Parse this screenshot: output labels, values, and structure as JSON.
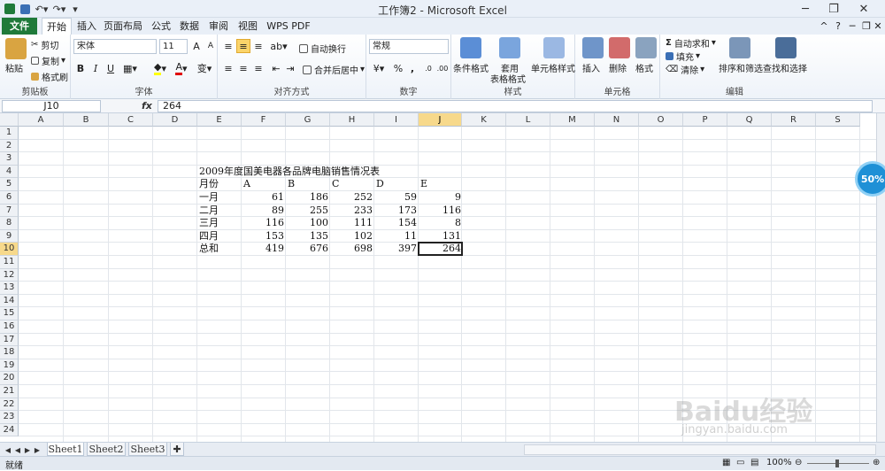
{
  "window": {
    "title": "工作簿2 - Microsoft Excel"
  },
  "tabs": [
    "文件",
    "开始",
    "插入",
    "页面布局",
    "公式",
    "数据",
    "审阅",
    "视图",
    "WPS PDF"
  ],
  "ribbon": {
    "clipboard": {
      "paste": "粘贴",
      "cut": "剪切",
      "copy": "复制",
      "format_painter": "格式刷",
      "label": "剪贴板"
    },
    "font": {
      "name": "宋体",
      "size": "11",
      "bold": "B",
      "italic": "I",
      "underline": "U",
      "label": "字体"
    },
    "alignment": {
      "wrap": "自动换行",
      "merge": "合并后居中",
      "label": "对齐方式"
    },
    "number": {
      "format": "常规",
      "percent": "%",
      "comma": ",",
      "label": "数字"
    },
    "styles": {
      "conditional": "条件格式",
      "table_format_1": "套用",
      "table_format_2": "表格格式",
      "cell_styles": "单元格样式",
      "label": "样式"
    },
    "cells": {
      "insert": "插入",
      "delete": "删除",
      "format": "格式",
      "label": "单元格"
    },
    "editing": {
      "autosum": "自动求和",
      "fill": "填充",
      "clear": "清除",
      "sort": "排序和筛选",
      "find": "查找和选择",
      "label": "编辑"
    }
  },
  "formula_bar": {
    "name_box": "J10",
    "fx": "fx",
    "content": "264"
  },
  "columns": [
    "A",
    "B",
    "C",
    "D",
    "E",
    "F",
    "G",
    "H",
    "I",
    "J",
    "K",
    "L",
    "M",
    "N",
    "O",
    "P",
    "Q",
    "R",
    "S"
  ],
  "rows": [
    "1",
    "2",
    "3",
    "4",
    "5",
    "6",
    "7",
    "8",
    "9",
    "10",
    "11",
    "12",
    "13",
    "14",
    "15",
    "16",
    "17",
    "18",
    "19",
    "20",
    "21",
    "22",
    "23",
    "24"
  ],
  "sheet": {
    "title": "2009年度国美电器各品牌电脑销售情况表",
    "header": [
      "月份",
      "A",
      "B",
      "C",
      "D",
      "E"
    ],
    "data_rows": [
      [
        "一月",
        "61",
        "186",
        "252",
        "59",
        "9"
      ],
      [
        "二月",
        "89",
        "255",
        "233",
        "173",
        "116"
      ],
      [
        "三月",
        "116",
        "100",
        "111",
        "154",
        "8"
      ],
      [
        "四月",
        "153",
        "135",
        "102",
        "11",
        "131"
      ],
      [
        "总和",
        "419",
        "676",
        "698",
        "397",
        "264"
      ]
    ]
  },
  "sheet_tabs": [
    "Sheet1",
    "Sheet2",
    "Sheet3"
  ],
  "status": {
    "ready": "就绪",
    "zoom": "100%"
  },
  "overlay": {
    "badge": "50%",
    "watermark": "Baidu经验",
    "watermark_url": "jingyan.baidu.com"
  }
}
